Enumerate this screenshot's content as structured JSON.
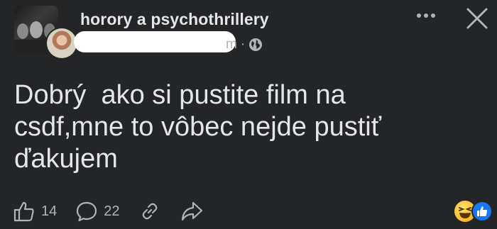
{
  "post": {
    "group_name": "horory a psychothrillery",
    "time": "m",
    "separator": "·",
    "visibility_icon": "globe-icon",
    "text": "Dobrý  ako si pustite film na\ncsdf,mne to vôbec nejde pustiť\nďakujem"
  },
  "header": {
    "more_icon": "more-horizontal-icon",
    "close_icon": "close-icon"
  },
  "actions": {
    "like_count": "14",
    "comment_count": "22"
  },
  "reactions": {
    "icons": [
      "haha-reaction-icon",
      "like-reaction-icon"
    ]
  },
  "colors": {
    "background": "#242526",
    "text_primary": "#e4e6eb",
    "text_secondary": "#b0b3b8",
    "like_blue": "#1877f2",
    "haha_yellow": "#f7b928"
  }
}
